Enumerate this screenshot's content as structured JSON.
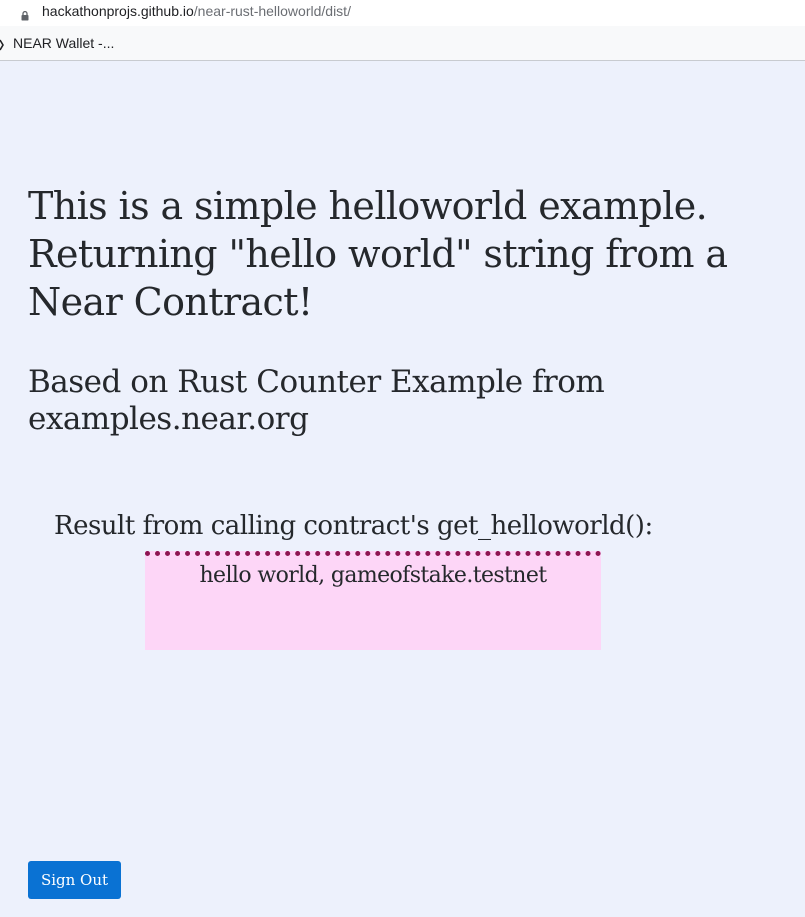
{
  "browser": {
    "url_host": "hackathonprojs.github.io",
    "url_path": "/near-rust-helloworld/dist/",
    "icon": "lock-icon"
  },
  "bookmarks": {
    "items": [
      {
        "label": "NEAR Wallet -...",
        "icon": "bookmark-favicon-icon"
      }
    ]
  },
  "main": {
    "heading": "This is a simple helloworld example. Returning \"hello world\" string from a Near Contract!",
    "subheading": "Based on Rust Counter Example from examples.near.org",
    "result_label": "Result from calling contract's get_helloworld():",
    "result_value": "hello world, gameofstake.testnet"
  },
  "actions": {
    "sign_out_label": "Sign Out"
  },
  "colors": {
    "page_background": "#edf1fc",
    "result_box_background": "#fdd6f7",
    "result_box_border": "#8e1452",
    "button_background": "#0a72d3",
    "text": "#25282c"
  }
}
